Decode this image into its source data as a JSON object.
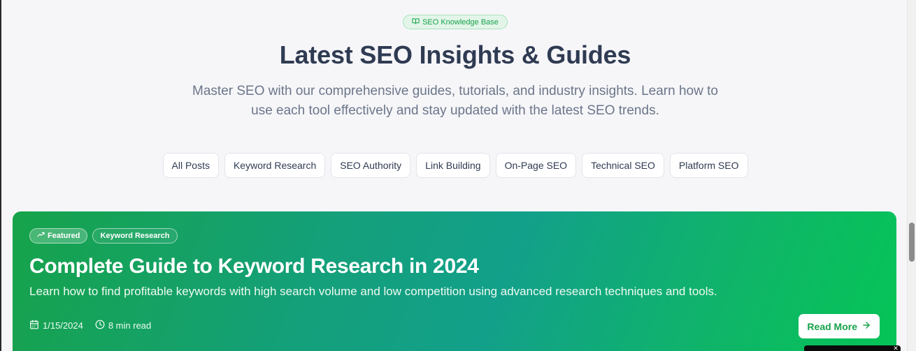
{
  "hero": {
    "badge_label": "SEO Knowledge Base",
    "badge_icon": "book-open-icon",
    "title": "Latest SEO Insights & Guides",
    "subtitle": "Master SEO with our comprehensive guides, tutorials, and industry insights. Learn how to use each tool effectively and stay updated with the latest SEO trends."
  },
  "filters": [
    {
      "label": "All Posts"
    },
    {
      "label": "Keyword Research"
    },
    {
      "label": "SEO Authority"
    },
    {
      "label": "Link Building"
    },
    {
      "label": "On-Page SEO"
    },
    {
      "label": "Technical SEO"
    },
    {
      "label": "Platform SEO"
    }
  ],
  "featured_post": {
    "featured_badge": "Featured",
    "featured_icon": "trending-up-icon",
    "category_badge": "Keyword Research",
    "title": "Complete Guide to Keyword Research in 2024",
    "description": "Learn how to find profitable keywords with high search volume and low competition using advanced research techniques and tools.",
    "date": "1/15/2024",
    "date_icon": "calendar-icon",
    "read_time": "8 min read",
    "read_time_icon": "clock-icon",
    "read_more_label": "Read More",
    "read_more_icon": "arrow-right-icon"
  },
  "colors": {
    "brand_green": "#16a34a",
    "title_text": "#2f3b52",
    "muted_text": "#6b7689",
    "page_background": "#f6f6f9"
  }
}
